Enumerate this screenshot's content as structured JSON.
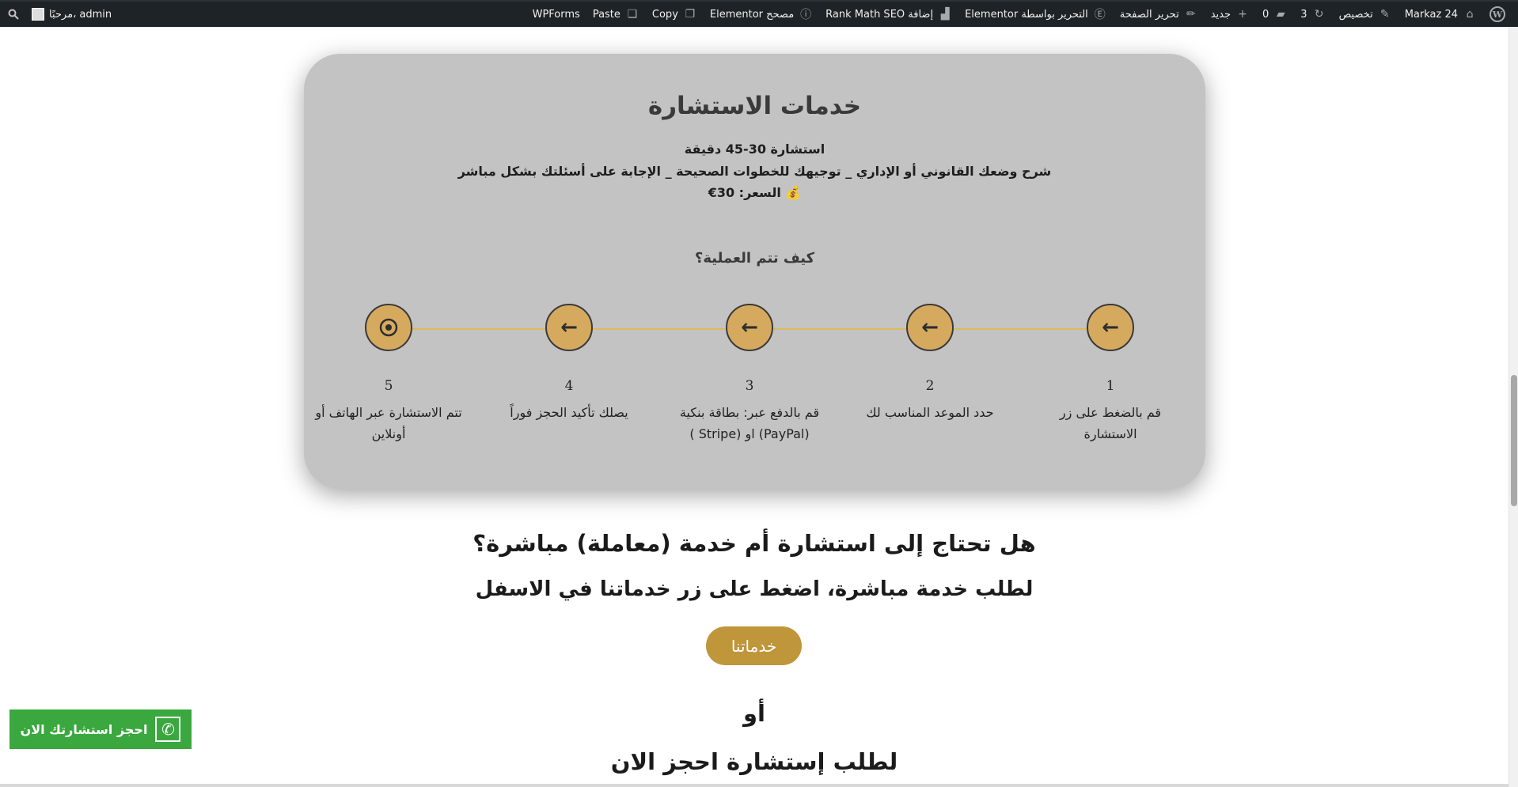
{
  "adminbar": {
    "right_items": [
      {
        "label": "Markaz 24",
        "icon": "home-icon"
      },
      {
        "label": "تخصيص",
        "icon": "brush-icon"
      },
      {
        "label": "3",
        "icon": "updates-icon"
      },
      {
        "label": "0",
        "icon": "comments-icon"
      },
      {
        "label": "جديد",
        "icon": "plus-icon"
      },
      {
        "label": "تحرير الصفحة",
        "icon": "pencil-icon"
      },
      {
        "label": "التحرير بواسطة Elementor",
        "icon": "elementor-icon"
      },
      {
        "label": "إضافة Rank Math SEO",
        "icon": "rankmath-icon"
      },
      {
        "label": "مصحح Elementor",
        "icon": "info-icon"
      },
      {
        "label": "Copy",
        "icon": "copy-icon"
      },
      {
        "label": "Paste",
        "icon": "paste-icon"
      },
      {
        "label": "WPForms",
        "icon": ""
      }
    ],
    "greeting": "مرحبًا، admin"
  },
  "card": {
    "title": "خدمات الاستشارة",
    "line1": "استشارة 30-45 دقيقة",
    "line2": "شرح وضعك القانوني أو الإداري _ توجيهك للخطوات الصحيحة _ الإجابة على أسئلتك بشكل مباشر",
    "line3": "💰 السعر: 30€",
    "how_title": "كيف تتم العملية؟",
    "steps": [
      {
        "num": "1",
        "text": "قم بالضغط على زر الاستشارة",
        "icon": "arrow-left-icon"
      },
      {
        "num": "2",
        "text": "حدد الموعد المناسب لك",
        "icon": "arrow-left-icon"
      },
      {
        "num": "3",
        "text": "قم بالدفع عبر: بطاقة بنكية (PayPal) او (Stripe )",
        "icon": "arrow-left-icon"
      },
      {
        "num": "4",
        "text": "يصلك تأكيد الحجز فوراً",
        "icon": "arrow-left-icon"
      },
      {
        "num": "5",
        "text": "تتم الاستشارة عبر الهاتف أو أونلاين",
        "icon": "target-icon"
      }
    ]
  },
  "question_title": "هل تحتاج إلى استشارة أم خدمة (معاملة) مباشرة؟",
  "sub_title": "لطلب خدمة مباشرة، اضغط على زر خدماتنا في الاسفل",
  "services_button": "خدماتنا",
  "or_text": "أو",
  "book_title": "لطلب إستشارة احجز الان",
  "book_button": "احجز استشارتك الان",
  "colors": {
    "adminbar": "#1d2327",
    "card_bg": "#c3c3c3",
    "gold": "#d6aa5e",
    "button_gold": "#c0963b",
    "green": "#3aa83f"
  }
}
